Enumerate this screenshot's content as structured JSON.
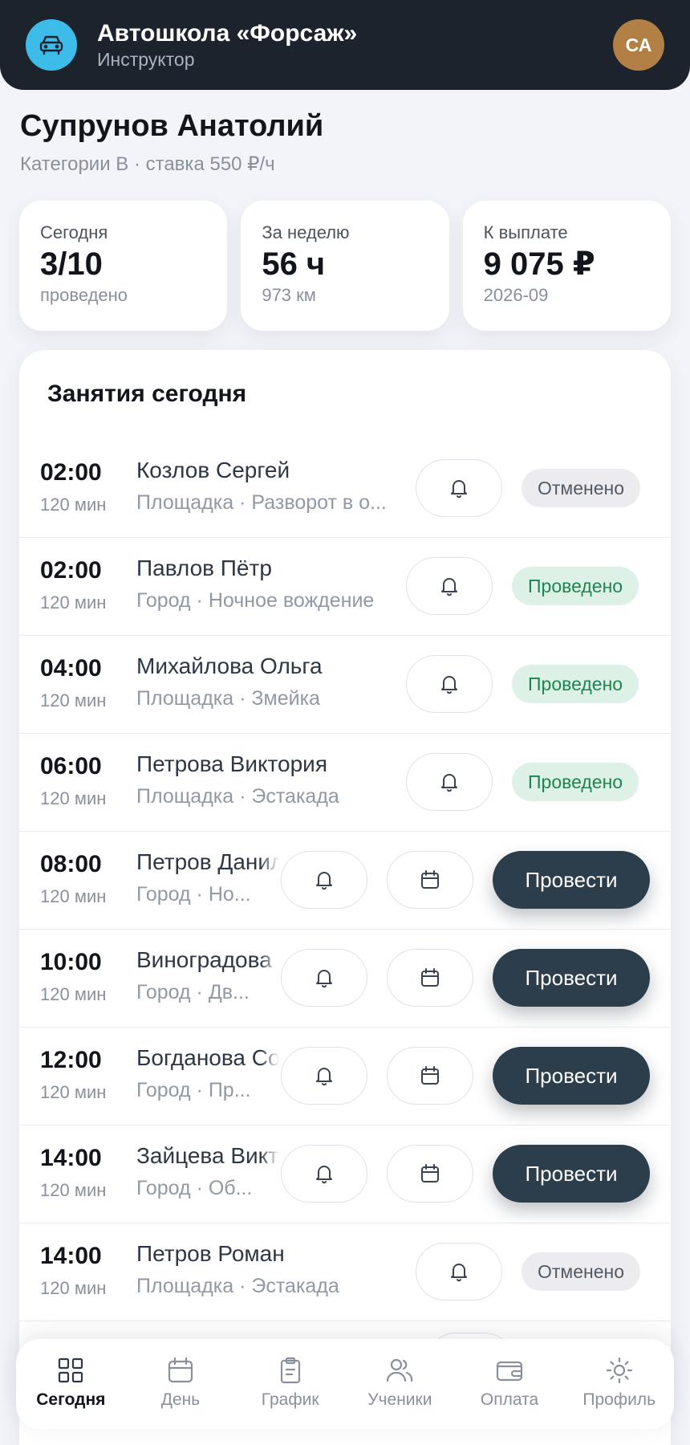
{
  "header": {
    "title": "Автошкола «Форсаж»",
    "subtitle": "Инструктор",
    "avatar_initials": "СА",
    "logo_icon": "car-icon"
  },
  "instructor": {
    "name": "Супрунов Анатолий",
    "meta": "Категории B · ставка 550 ₽/ч"
  },
  "stats": [
    {
      "label": "Сегодня",
      "value": "3/10",
      "sub": "проведено"
    },
    {
      "label": "За неделю",
      "value": "56 ч",
      "sub": "973 км"
    },
    {
      "label": "К выплате",
      "value": "9 075 ₽",
      "sub": "2026-09"
    }
  ],
  "lessons": {
    "title": "Занятия сегодня",
    "items": [
      {
        "time": "02:00",
        "duration": "120 мин",
        "student": "Козлов Сергей",
        "info": "Площадка · Разворот в о...",
        "status": "Отменено"
      },
      {
        "time": "02:00",
        "duration": "120 мин",
        "student": "Павлов Пётр",
        "info": "Город · Ночное вождение",
        "status": "Проведено"
      },
      {
        "time": "04:00",
        "duration": "120 мин",
        "student": "Михайлова Ольга",
        "info": "Площадка · Змейка",
        "status": "Проведено"
      },
      {
        "time": "06:00",
        "duration": "120 мин",
        "student": "Петрова Виктория",
        "info": "Площадка · Эстакада",
        "status": "Проведено"
      },
      {
        "time": "08:00",
        "duration": "120 мин",
        "student": "Петров Данил",
        "info": "Город · Но...",
        "action": "Провести"
      },
      {
        "time": "10:00",
        "duration": "120 мин",
        "student": "Виноградова",
        "info": "Город · Дв...",
        "action": "Провести"
      },
      {
        "time": "12:00",
        "duration": "120 мин",
        "student": "Богданова Со",
        "info": "Город · Пр...",
        "action": "Провести"
      },
      {
        "time": "14:00",
        "duration": "120 мин",
        "student": "Зайцева Викт",
        "info": "Город · Об...",
        "action": "Провести"
      },
      {
        "time": "14:00",
        "duration": "120 мин",
        "student": "Петров Роман",
        "info": "Площадка · Эстакада",
        "status": "Отменено"
      }
    ]
  },
  "nav": {
    "items": [
      {
        "label": "Сегодня",
        "icon": "grid-icon"
      },
      {
        "label": "День",
        "icon": "calendar-icon"
      },
      {
        "label": "График",
        "icon": "clipboard-icon"
      },
      {
        "label": "Ученики",
        "icon": "users-icon"
      },
      {
        "label": "Оплата",
        "icon": "wallet-icon"
      },
      {
        "label": "Профиль",
        "icon": "sun-icon"
      }
    ],
    "active": "Сегодня"
  },
  "colors": {
    "header_bg": "#1c232c",
    "logo_bg": "#3dbbe9",
    "avatar_bg": "#b27f44",
    "primary_button": "#2c3e4b",
    "status_done_bg": "#def1e6",
    "status_done_text": "#1d8551",
    "status_cancel_bg": "#ececf0"
  }
}
